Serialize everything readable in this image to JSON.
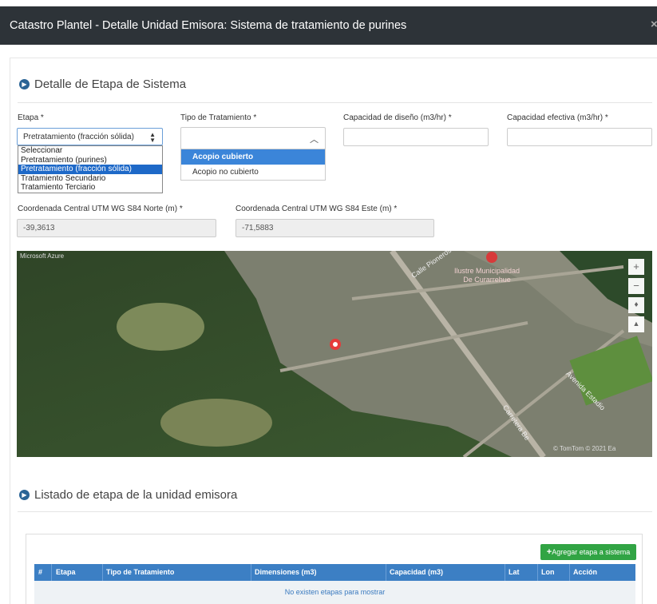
{
  "window": {
    "title": "Catastro Plantel - Detalle Unidad Emisora: Sistema de tratamiento de purines",
    "close_glyph": "×"
  },
  "section1": {
    "title": "Detalle de Etapa de Sistema",
    "etapa_label": "Etapa *",
    "etapa_value": "Pretratamiento (fracción sólida)",
    "etapa_options": [
      "Seleccionar",
      "Pretratamiento (purines)",
      "Pretratamiento (fracción sólida)",
      "Tratamiento Secundario",
      "Tratamiento Terciario"
    ],
    "tipo_label": "Tipo de Tratamiento *",
    "tipo_options": [
      "Acopio cubierto",
      "Acopio no cubierto"
    ],
    "cap_diseno_label": "Capacidad de diseño (m3/hr) *",
    "cap_efectiva_label": "Capacidad efectiva (m3/hr) *",
    "norte_label": "Coordenada Central UTM WG S84 Norte (m) *",
    "norte_value": "-39,3613",
    "este_label": "Coordenada Central UTM WG S84 Este (m) *",
    "este_value": "-71,5883"
  },
  "map": {
    "provider": "Microsoft Azure",
    "labels": [
      "Ilustre Municipalidad",
      "De Curarrehue",
      "Calle Pioneros",
      "Avenida Estadio",
      "Carretera Be"
    ],
    "copyright": "© TomTom © 2021 Ea",
    "zoom_in": "+",
    "zoom_out": "−",
    "compass_glyph": "♦",
    "mode_glyph": "▲"
  },
  "section2": {
    "title": "Listado de etapa de la unidad emisora",
    "add_button": "Agregar etapa a sistema",
    "columns": [
      "#",
      "Etapa",
      "Tipo de Tratamiento",
      "Dimensiones (m3)",
      "Capacidad (m3)",
      "Lat",
      "Lon",
      "Acción"
    ],
    "empty_message": "No existen etapas para mostrar"
  },
  "colors": {
    "header_bg": "#2d3338",
    "table_header": "#3c7fc4",
    "add_button": "#31a444",
    "dropdown_selected": "#1e69c8"
  }
}
